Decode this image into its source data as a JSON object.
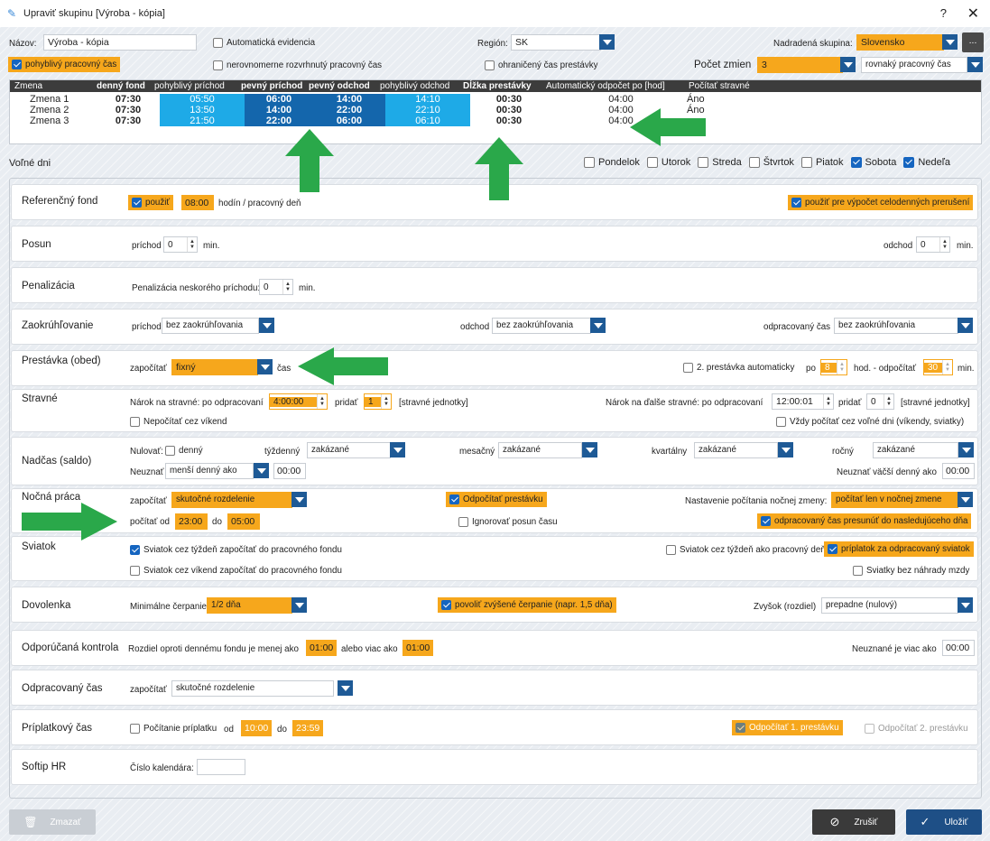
{
  "window": {
    "title": "Upraviť skupinu [Výroba - kópia]",
    "help": "?",
    "close": "✕"
  },
  "header": {
    "name_label": "Názov:",
    "name_value": "Výroba - kópia",
    "auto_evid": "Automatická evidencia",
    "region_label": "Región:",
    "region_value": "SK",
    "parent_label": "Nadradená skupina:",
    "parent_value": "Slovensko",
    "more": "...",
    "flex_time": "pohyblivý pracovný čas",
    "uneven": "nerovnomerne rozvrhnutý pracovný čas",
    "limited_break": "ohraničený čas prestávky",
    "shifts_label": "Počet zmien",
    "shifts_value": "3",
    "time_type": "rovnaký pracovný čas"
  },
  "grid": {
    "headers": [
      "Zmena",
      "denný fond",
      "pohyblivý príchod",
      "pevný príchod",
      "pevný odchod",
      "pohyblivý odchod",
      "Dĺžka prestávky",
      "Automatický odpočet po [hod]",
      "Počítať stravné"
    ],
    "rows": [
      {
        "name": "Zmena 1",
        "fund": "07:30",
        "flex_in": "05:50",
        "fix_in": "06:00",
        "fix_out": "14:00",
        "flex_out": "14:10",
        "brk": "00:30",
        "auto": "04:00",
        "meal": "Áno"
      },
      {
        "name": "Zmena 2",
        "fund": "07:30",
        "flex_in": "13:50",
        "fix_in": "14:00",
        "fix_out": "22:00",
        "flex_out": "22:10",
        "brk": "00:30",
        "auto": "04:00",
        "meal": "Áno"
      },
      {
        "name": "Zmena 3",
        "fund": "07:30",
        "flex_in": "21:50",
        "fix_in": "22:00",
        "fix_out": "06:00",
        "flex_out": "06:10",
        "brk": "00:30",
        "auto": "04:00",
        "meal": ""
      }
    ]
  },
  "free_days": {
    "label": "Voľné dni",
    "days": [
      {
        "name": "Pondelok",
        "on": false
      },
      {
        "name": "Utorok",
        "on": false
      },
      {
        "name": "Streda",
        "on": false
      },
      {
        "name": "Štvrtok",
        "on": false
      },
      {
        "name": "Piatok",
        "on": false
      },
      {
        "name": "Sobota",
        "on": true
      },
      {
        "name": "Nedeľa",
        "on": true
      }
    ]
  },
  "ref": {
    "title": "Referenčný fond",
    "use": "použiť",
    "hours": "08:00",
    "unit": "hodín / pracovný deň",
    "use_full": "použiť pre výpočet celodenných prerušení"
  },
  "shift": {
    "title": "Posun",
    "arrival": "príchod",
    "arrival_v": "0",
    "min": "min.",
    "departure": "odchod",
    "departure_v": "0"
  },
  "penalty": {
    "title": "Penalizácia",
    "label": "Penalizácia neskorého príchodu:",
    "value": "0",
    "min": "min."
  },
  "round": {
    "title": "Zaokrúhľovanie",
    "arrival": "príchod",
    "arrival_v": "bez zaokrúhľovania",
    "departure": "odchod",
    "departure_v": "bez zaokrúhľovania",
    "worked": "odpracovaný čas",
    "worked_v": "bez zaokrúhľovania"
  },
  "break": {
    "title": "Prestávka (obed)",
    "count": "započítať",
    "count_v": "fixný",
    "time": "čas",
    "second": "2. prestávka automaticky",
    "po": "po",
    "po_v": "8",
    "hod": "hod. - odpočítať",
    "ded_v": "30",
    "min": "min."
  },
  "meal": {
    "title": "Stravné",
    "claim": "Nárok na stravné: po odpracovaní",
    "claim_v": "4:00:00",
    "add": "pridať",
    "add_v": "1",
    "units": "[stravné jednotky]",
    "claim2": "Nárok na ďalše stravné: po odpracovaní",
    "claim2_v": "12:00:01",
    "add2_v": "0",
    "no_weekend": "Nepočítať cez víkend",
    "always": "Vždy počítať cez voľné dni (víkendy, sviatky)"
  },
  "overtime": {
    "title": "Nadčas (saldo)",
    "reset": "Nulovať:",
    "daily": "denný",
    "weekly": "týždenný",
    "weekly_v": "zakázané",
    "monthly": "mesačný",
    "monthly_v": "zakázané",
    "quarterly": "kvartálny",
    "quarterly_v": "zakázané",
    "yearly": "ročný",
    "yearly_v": "zakázané",
    "ignore": "Neuznať",
    "ignore_v": "menší denný ako",
    "ignore_t": "00:00",
    "ignore_big": "Neuznať väčší denný ako",
    "ignore_big_v": "00:00"
  },
  "night": {
    "title": "Nočná práca",
    "count": "započítať",
    "count_v": "skutočné rozdelenie",
    "deduct": "Odpočítať prestávku",
    "setting": "Nastavenie počítania nočnej zmeny:",
    "setting_v": "počítať len v nočnej zmene",
    "from": "počítať od",
    "from_v": "23:00",
    "to": "do",
    "to_v": "05:00",
    "ignore_shift": "Ignorovať posun času",
    "move": "odpracovaný čas presunúť do nasledujúceho dňa"
  },
  "holiday": {
    "title": "Sviatok",
    "wk_fund": "Sviatok cez týždeň započítať do pracovného fondu",
    "wk_day": "Sviatok cez týždeň ako pracovný deň",
    "bonus": "príplatok za odpracovaný sviatok",
    "we_fund": "Sviatok cez víkend započítať do pracovného fondu",
    "no_pay": "Sviatky bez náhrady mzdy"
  },
  "vacation": {
    "title": "Dovolenka",
    "min": "Minimálne čerpanie",
    "min_v": "1/2 dňa",
    "raised": "povoliť zvýšené čerpanie (napr. 1,5 dňa)",
    "rest": "Zvyšok (rozdiel)",
    "rest_v": "prepadne (nulový)"
  },
  "check": {
    "title": "Odporúčaná kontrola",
    "diff": "Rozdiel oproti dennému fondu je menej ako",
    "diff_v": "01:00",
    "more": "alebo viac ako",
    "more_v": "01:00",
    "unrec": "Neuznané je viac ako",
    "unrec_v": "00:00"
  },
  "worked": {
    "title": "Odpracovaný čas",
    "count": "započítať",
    "count_v": "skutočné rozdelenie"
  },
  "bonus": {
    "title": "Príplatkový čas",
    "calc": "Počítanie príplatku",
    "from": "od",
    "from_v": "10:00",
    "to": "do",
    "to_v": "23:59",
    "ded1": "Odpočítať 1. prestávku",
    "ded2": "Odpočítať 2. prestávku"
  },
  "softip": {
    "title": "Softip HR",
    "cal": "Číslo kalendára:",
    "cal_v": ""
  },
  "footer": {
    "delete": "Zmazať",
    "cancel": "Zrušiť",
    "save": "Uložiť"
  },
  "colors": {
    "accent": "#f6a71c",
    "primary": "#1e5a96",
    "cyan": "#1eaae7",
    "green": "#2aa84a"
  }
}
